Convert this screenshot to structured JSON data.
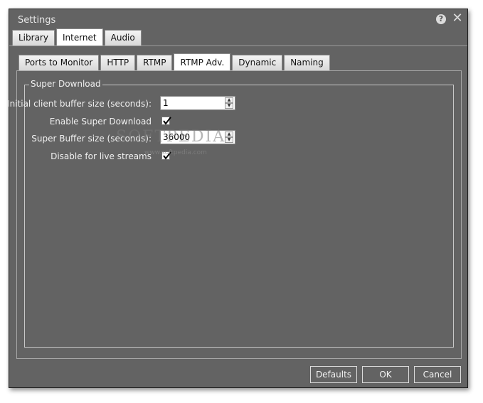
{
  "window": {
    "title": "Settings"
  },
  "titlebar_icons": {
    "help": "help-icon",
    "close": "close-icon"
  },
  "tabs_main": [
    {
      "label": "Library",
      "active": false
    },
    {
      "label": "Internet",
      "active": true
    },
    {
      "label": "Audio",
      "active": false
    }
  ],
  "tabs_sub": [
    {
      "label": "Ports to Monitor",
      "active": false
    },
    {
      "label": "HTTP",
      "active": false
    },
    {
      "label": "RTMP",
      "active": false
    },
    {
      "label": "RTMP Adv.",
      "active": true
    },
    {
      "label": "Dynamic",
      "active": false
    },
    {
      "label": "Naming",
      "active": false
    }
  ],
  "group": {
    "title": "Super Download",
    "initial_buffer": {
      "label": "Initial client buffer size (seconds):",
      "value": "1"
    },
    "enable_super": {
      "label": "Enable Super Download",
      "checked": true
    },
    "super_buffer": {
      "label": "Super Buffer size (seconds):",
      "value": "36000"
    },
    "disable_live": {
      "label": "Disable for live streams",
      "checked": true
    }
  },
  "watermark": {
    "text": "SOFTPEDIA",
    "url": "www.softpedia.com"
  },
  "buttons": {
    "defaults": "Defaults",
    "ok": "OK",
    "cancel": "Cancel"
  },
  "colors": {
    "background": "#636363",
    "text": "#f0f0f0"
  }
}
